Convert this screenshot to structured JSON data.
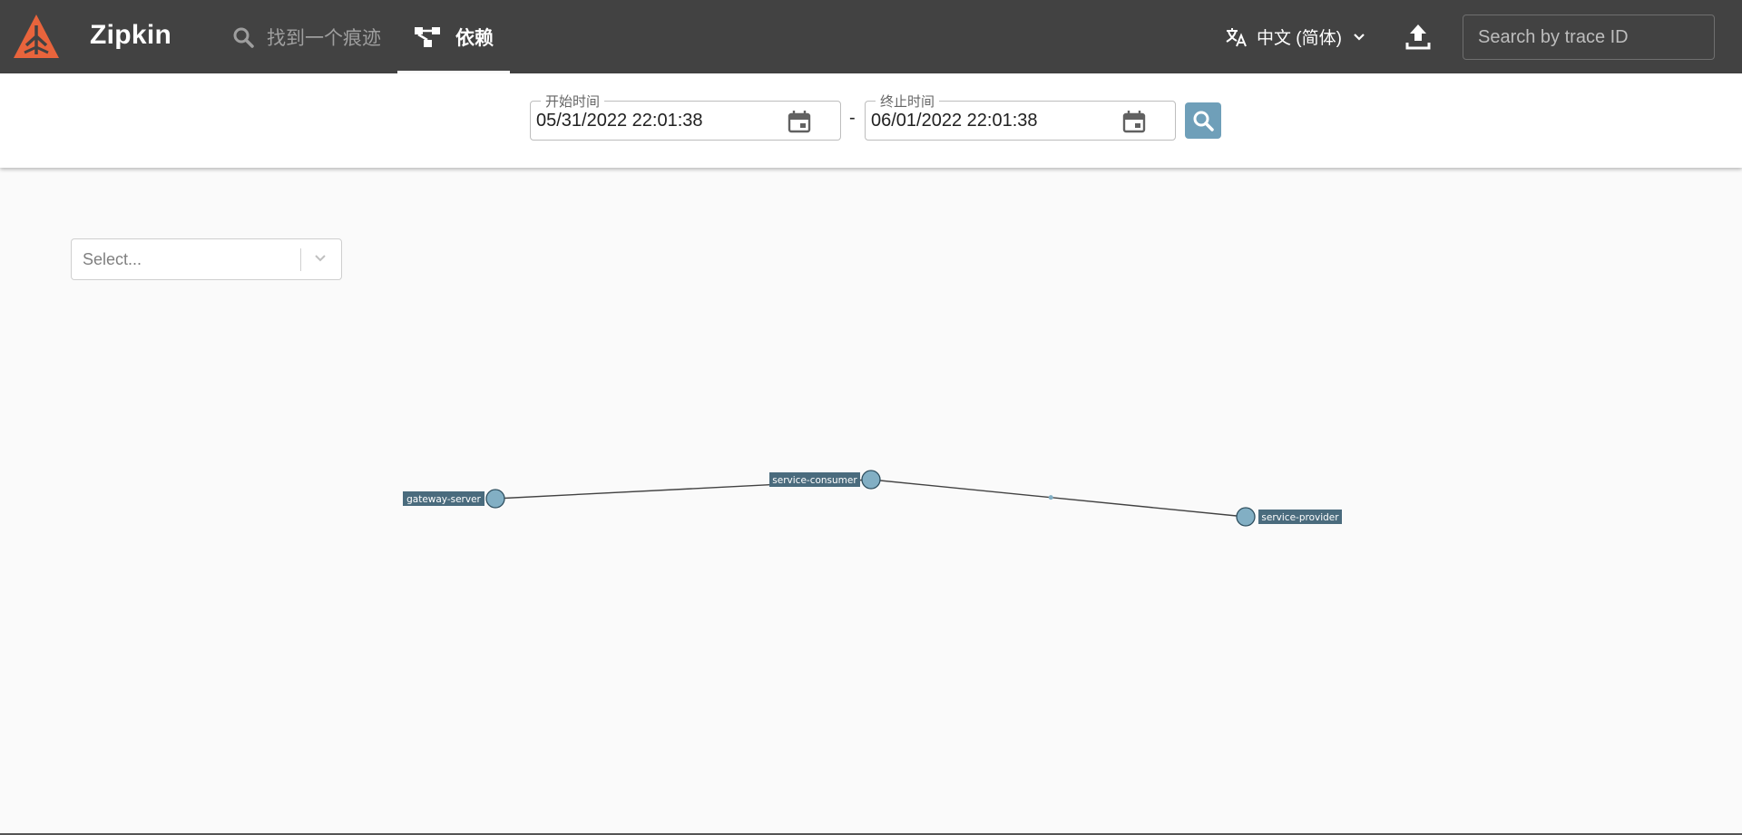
{
  "header": {
    "brand": "Zipkin",
    "nav_search_label": "找到一个痕迹",
    "nav_dependencies_label": "依赖",
    "language_label": "中文 (简体)",
    "trace_search_placeholder": "Search by trace ID"
  },
  "date_filter": {
    "start_label": "开始时间",
    "start_value": "05/31/2022 22:01:38",
    "separator": "-",
    "end_label": "终止时间",
    "end_value": "06/01/2022 22:01:38"
  },
  "service_select": {
    "placeholder": "Select..."
  },
  "dependency_graph": {
    "nodes": [
      {
        "name": "gateway-server"
      },
      {
        "name": "service-consumer"
      },
      {
        "name": "service-provider"
      }
    ],
    "edges": [
      {
        "from": "gateway-server",
        "to": "service-consumer"
      },
      {
        "from": "service-consumer",
        "to": "service-provider"
      }
    ]
  },
  "colors": {
    "appbar": "#424242",
    "accent": "#6f9fb9",
    "logo": "#e8643c",
    "node_fill": "#82afc4",
    "label_bg": "#4a6b7d"
  }
}
